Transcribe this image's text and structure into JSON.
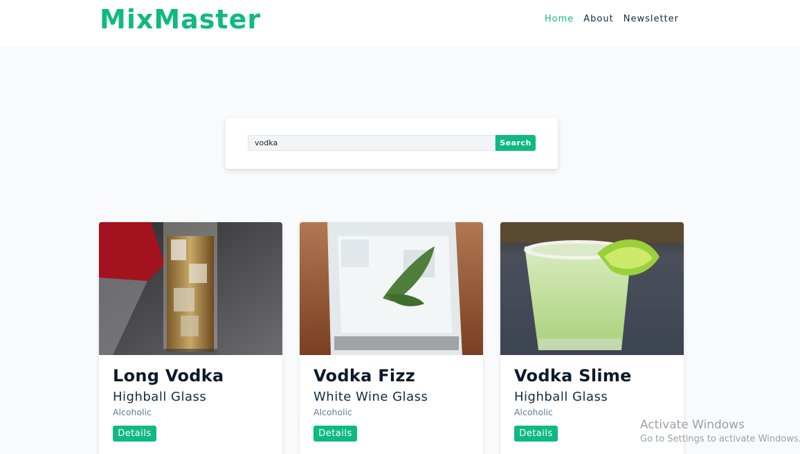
{
  "brand": {
    "name": "MixMaster",
    "color": "#10b981"
  },
  "nav": {
    "links": [
      {
        "label": "Home",
        "active": true
      },
      {
        "label": "About",
        "active": false
      },
      {
        "label": "Newsletter",
        "active": false
      }
    ]
  },
  "search": {
    "value": "vodka",
    "button_label": "Search"
  },
  "cocktails": [
    {
      "name": "Long Vodka",
      "glass": "Highball Glass",
      "type": "Alcoholic",
      "button_label": "Details"
    },
    {
      "name": "Vodka Fizz",
      "glass": "White Wine Glass",
      "type": "Alcoholic",
      "button_label": "Details"
    },
    {
      "name": "Vodka Slime",
      "glass": "Highball Glass",
      "type": "Alcoholic",
      "button_label": "Details"
    }
  ],
  "watermark": {
    "title": "Activate Windows",
    "subtitle": "Go to Settings to activate Windows."
  }
}
